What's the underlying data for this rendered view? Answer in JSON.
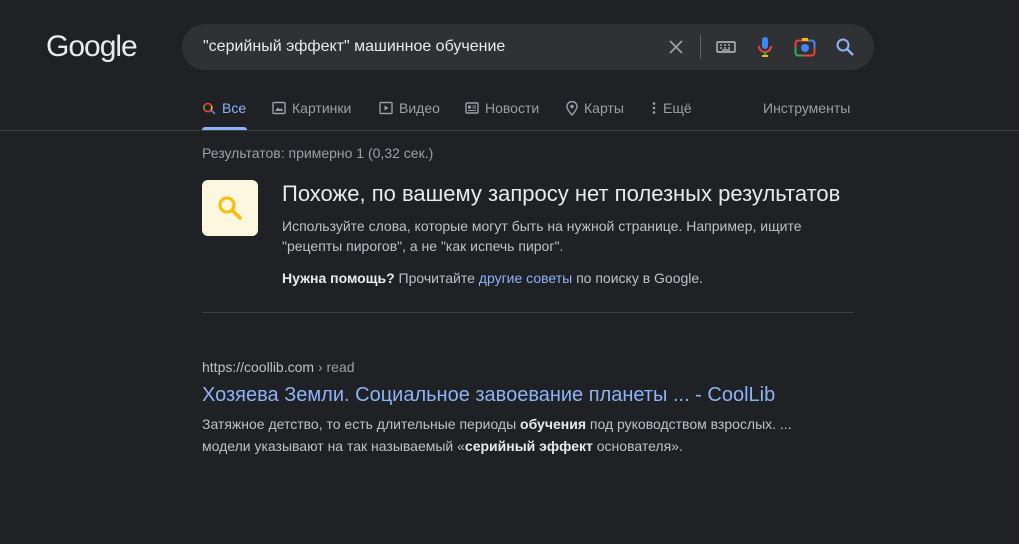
{
  "logo": "Google",
  "search": {
    "query": "\"серийный эффект\" машинное обучение"
  },
  "tabs": [
    {
      "label": "Все",
      "icon": "search-icon",
      "active": true
    },
    {
      "label": "Картинки",
      "icon": "image-icon"
    },
    {
      "label": "Видео",
      "icon": "play-icon"
    },
    {
      "label": "Новости",
      "icon": "news-icon"
    },
    {
      "label": "Карты",
      "icon": "map-pin-icon"
    },
    {
      "label": "Ещё",
      "icon": "more-vert-icon"
    }
  ],
  "tools_label": "Инструменты",
  "stats": "Результатов: примерно 1 (0,32 сек.)",
  "no_results": {
    "title": "Похоже, по вашему запросу нет полезных результатов",
    "text": "Используйте слова, которые могут быть на нужной странице. Например, ищите \"рецепты пирогов\", а не \"как испечь пирог\".",
    "help_bold": "Нужна помощь?",
    "help_pre": " Прочитайте ",
    "help_link": "другие советы",
    "help_post": " по поиску в Google."
  },
  "result": {
    "url": "https://coollib.com",
    "crumb": " › read",
    "title": "Хозяева Земли. Социальное завоевание планеты ... - CoolLib",
    "snippet": {
      "p1": "Затяжное детство, то есть длительные периоды ",
      "b1": "обучения",
      "p2": " под руководством взрослых. ... модели указывают на так называемый «",
      "b2": "серийный эффект",
      "p3": " основателя»."
    }
  },
  "colors": {
    "background": "#202124",
    "link": "#8ab4f8",
    "accent_box": "#fef7e0",
    "accent_icon": "#fbbc04"
  }
}
